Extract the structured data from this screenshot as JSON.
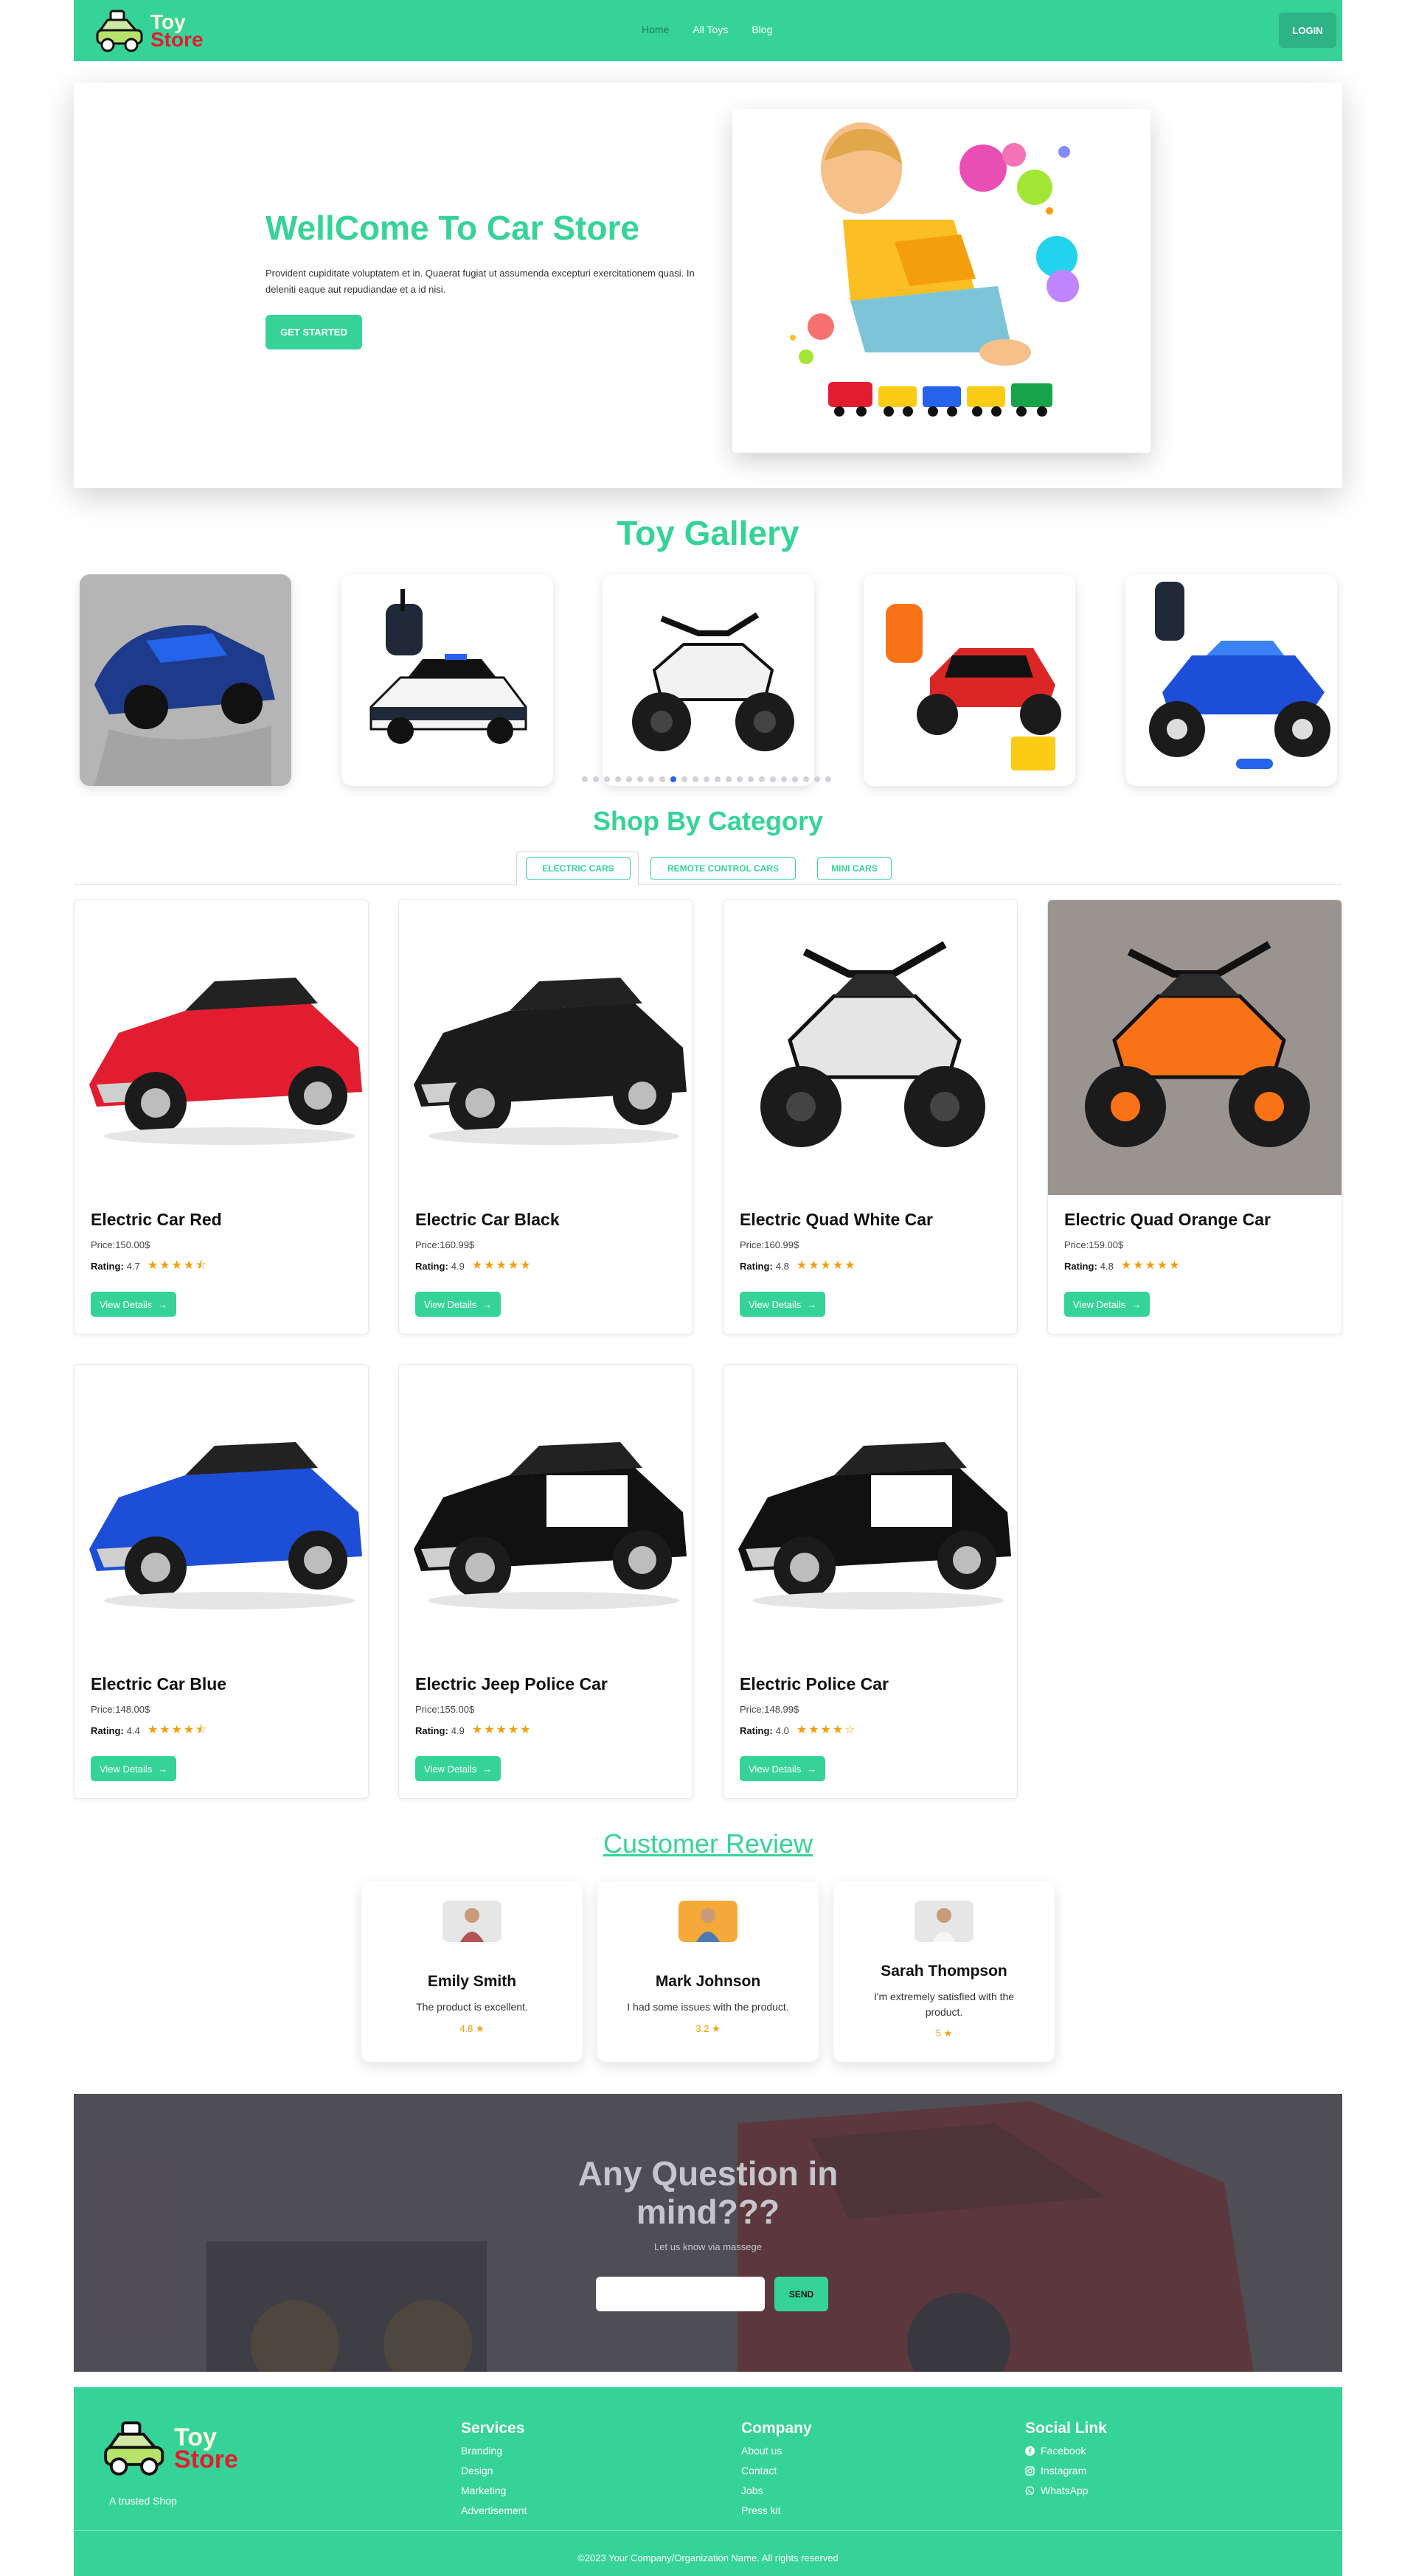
{
  "nav": {
    "brand_line1": "Toy",
    "brand_line2": "Store",
    "links": [
      "Home",
      "All Toys",
      "Blog"
    ],
    "login_label": "LOGIN"
  },
  "hero": {
    "title": "WellCome To Car Store",
    "description": "Provident cupiditate voluptatem et in. Quaerat fugiat ut assumenda excepturi exercitationem quasi. In deleniti eaque aut repudiandae et a id nisi.",
    "cta_label": "GET STARTED"
  },
  "gallery": {
    "title": "Toy Gallery",
    "dots_total": 23,
    "dots_active_index": 8
  },
  "category": {
    "title": "Shop By Category",
    "tabs": [
      "ELECTRIC CARS",
      "REMOTE CONTROL CARS",
      "MINI CARS"
    ],
    "rating_label": "Rating:",
    "button_label": "View Details",
    "products": [
      {
        "name": "Electric Car Red",
        "price": "Price:150.00$",
        "rating": "4.7",
        "stars": 4.5,
        "color": "#e11d2f"
      },
      {
        "name": "Electric Car Black",
        "price": "Price:160.99$",
        "rating": "4.9",
        "stars": 5,
        "color": "#1b1b1b"
      },
      {
        "name": "Electric Quad White Car",
        "price": "Price:160.99$",
        "rating": "4.8",
        "stars": 5,
        "color": "#e5e5e5"
      },
      {
        "name": "Electric Quad Orange Car",
        "price": "Price:159.00$",
        "rating": "4.8",
        "stars": 5,
        "color": "#f97316"
      },
      {
        "name": "Electric Car Blue",
        "price": "Price:148.00$",
        "rating": "4.4",
        "stars": 4.5,
        "color": "#1d4ed8"
      },
      {
        "name": "Electric Jeep Police Car",
        "price": "Price:155.00$",
        "rating": "4.9",
        "stars": 5,
        "color": "#111111"
      },
      {
        "name": "Electric Police Car",
        "price": "Price:148.99$",
        "rating": "4.0",
        "stars": 4,
        "color": "#111111"
      }
    ]
  },
  "reviews": {
    "title": "Customer Review",
    "items": [
      {
        "name": "Emily Smith",
        "text": "The product is excellent.",
        "score": "4.8"
      },
      {
        "name": "Mark Johnson",
        "text": "I had some issues with the product.",
        "score": "3.2"
      },
      {
        "name": "Sarah Thompson",
        "text": "I'm extremely satisfied with the product.",
        "score": "5"
      }
    ]
  },
  "contact": {
    "title_line1": "Any Question in",
    "title_line2": "mind???",
    "subtitle": "Let us know via massege",
    "send_label": "SEND"
  },
  "footer": {
    "tagline": "A trusted Shop",
    "services_title": "Services",
    "services": [
      "Branding",
      "Design",
      "Marketing",
      "Advertisement"
    ],
    "company_title": "Company",
    "company": [
      "About us",
      "Contact",
      "Jobs",
      "Press kit"
    ],
    "social_title": "Social Link",
    "social": [
      "Facebook",
      "Instagram",
      "WhatsApp"
    ],
    "copyright": "©2023 Your Company/Organization Name. All rights reserved"
  },
  "colors": {
    "accent": "#36d399",
    "star": "#f59e0b"
  }
}
